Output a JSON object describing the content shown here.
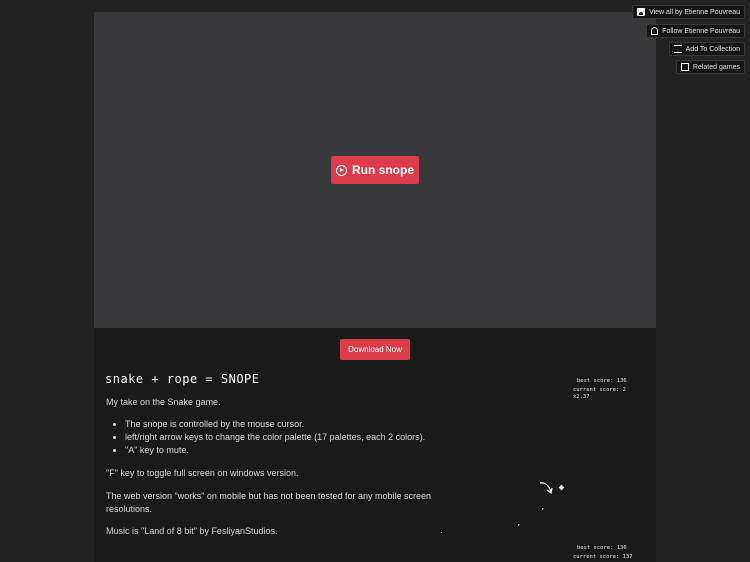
{
  "top_buttons": {
    "view_all": "View all by Etienne Pouvreau",
    "follow": "Follow Etienne Pouvreau",
    "add_to_collection": "Add To Collection",
    "related_games": "Related games"
  },
  "game": {
    "run_label": "Run snope",
    "download_label": "Download Now"
  },
  "description": {
    "title": "snake + rope = SNOPE",
    "intro": "My take on the Snake game.",
    "bullets": [
      "The snope is controlled by the mouse cursor.",
      "left/right arrow keys to change the color palette (17 palettes, each 2 colors).",
      "\"A\" key to mute."
    ],
    "fullscreen_note": "\"F\" key to toggle full screen on windows version.",
    "web_note": "The web version \"works\" on mobile but has not been tested for any mobile screen resolutions.",
    "music_note": "Music is \"Land of 8 bit\" by FesliyanStudios."
  },
  "screenshot": {
    "top": {
      "best_score": "best score: 136",
      "current_score": "current score: 2",
      "multiplier": "x2.37"
    },
    "bottom": {
      "best_score": "best score: 136",
      "current_score": "current score: 137"
    }
  },
  "colors": {
    "accent": "#dd3d4a",
    "background": "#222222",
    "game_frame": "#39383a"
  },
  "icons": {
    "run": "play-circle-icon",
    "view_all": "avatar-icon",
    "follow": "follow-user-icon",
    "add_to_collection": "playlist-add-icon",
    "related_games": "map-icon"
  }
}
